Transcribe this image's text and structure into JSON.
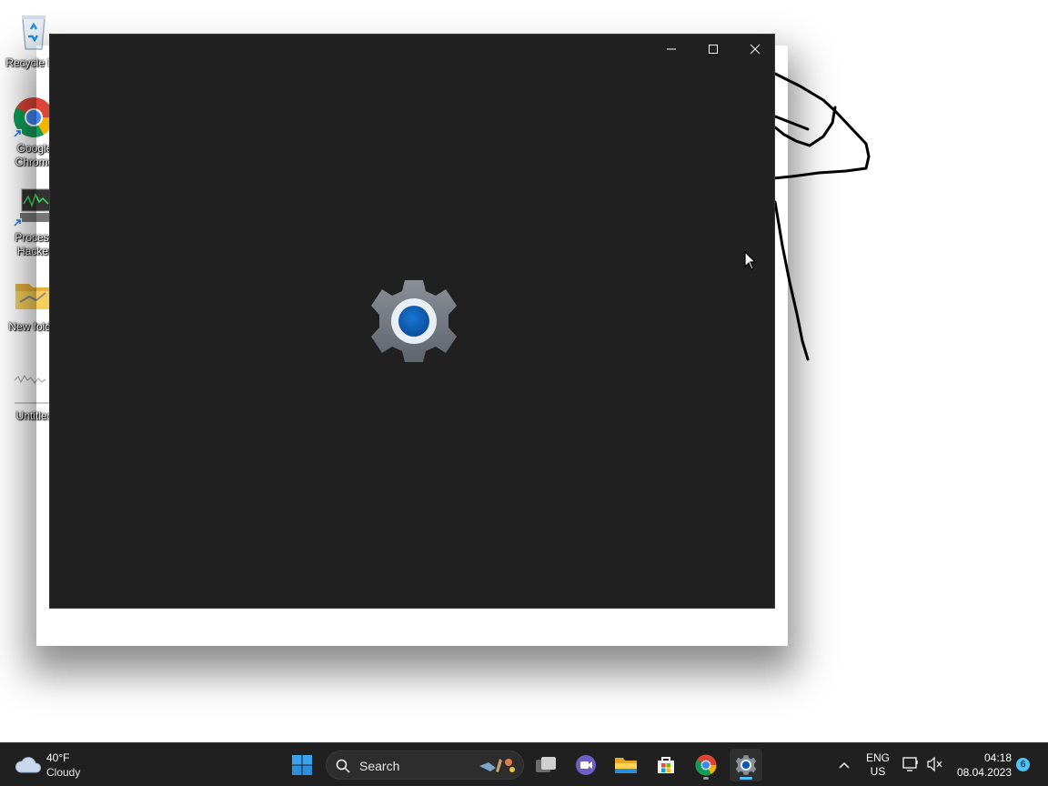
{
  "desktop": {
    "icons": [
      {
        "label": "Recycle Bin",
        "icon": "recycle-bin-icon"
      },
      {
        "label": "Google Chrome",
        "icon": "chrome-icon"
      },
      {
        "label": "Process Hacker",
        "icon": "process-hacker-icon"
      },
      {
        "label": "New folder",
        "icon": "folder-icon"
      },
      {
        "label": "Untitled",
        "icon": "image-file-icon"
      }
    ]
  },
  "window": {
    "app": "Settings",
    "splash_icon": "settings-gear-icon",
    "controls": [
      "minimize",
      "maximize",
      "close"
    ]
  },
  "taskbar": {
    "weather": {
      "temp": "40°F",
      "condition": "Cloudy",
      "icon": "cloud-icon"
    },
    "search": {
      "label": "Search"
    },
    "apps": [
      {
        "name": "start",
        "icon": "windows-start-icon"
      },
      {
        "name": "task-view",
        "icon": "task-view-icon"
      },
      {
        "name": "teams-meet",
        "icon": "meet-now-icon"
      },
      {
        "name": "file-explorer",
        "icon": "folder-icon"
      },
      {
        "name": "microsoft-store",
        "icon": "store-icon"
      },
      {
        "name": "chrome",
        "icon": "chrome-icon",
        "running": true
      },
      {
        "name": "settings",
        "icon": "settings-gear-icon",
        "active": true
      }
    ],
    "tray": {
      "lang_top": "ENG",
      "lang_bottom": "US",
      "time": "04:18",
      "date": "08.04.2023",
      "notification_count": "6"
    }
  },
  "colors": {
    "window_bg": "#202020",
    "taskbar_bg": "#202020",
    "accent": "#0067c0"
  }
}
